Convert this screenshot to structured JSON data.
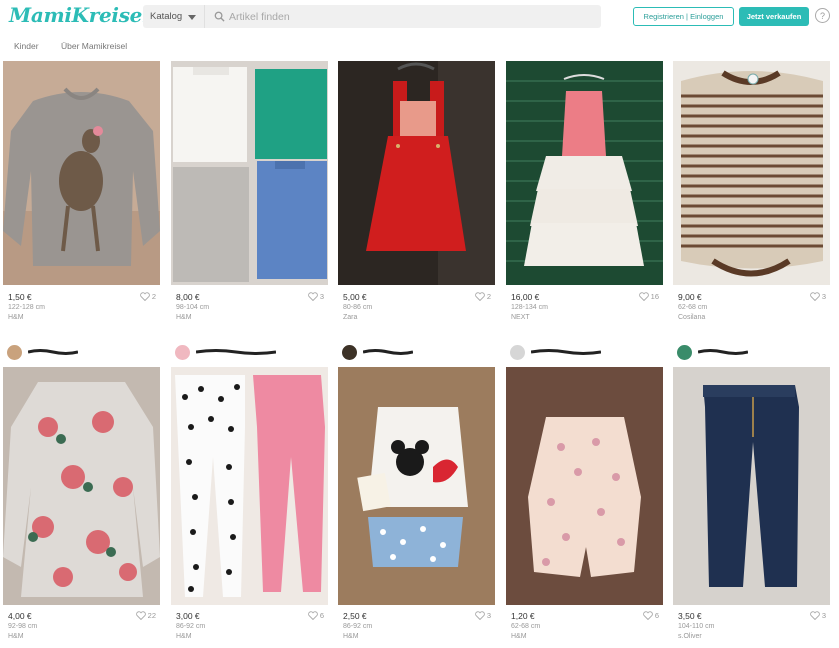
{
  "header": {
    "logo": "MamiKreisel",
    "catalog_label": "Katalog",
    "search_placeholder": "Artikel finden",
    "register_label": "Registrieren | Einloggen",
    "sell_label": "Jetzt verkaufen",
    "help_label": "?"
  },
  "subnav": {
    "items": [
      {
        "label": "Kinder"
      },
      {
        "label": "Über Mamikreisel"
      }
    ]
  },
  "items": [
    {
      "price": "1,50 €",
      "size": "122-128 cm",
      "brand": "H&M",
      "likes": "2",
      "photo": "deer-sweater",
      "bg": "#c0a590"
    },
    {
      "price": "8,00 €",
      "size": "98-104 cm",
      "brand": "H&M",
      "likes": "3",
      "photo": "four-shirts",
      "bg": "#d9d4cf"
    },
    {
      "price": "5,00 €",
      "size": "80-86 cm",
      "brand": "Zara",
      "likes": "2",
      "photo": "red-dress",
      "bg": "#2a2420"
    },
    {
      "price": "16,00 €",
      "size": "128-134 cm",
      "brand": "NEXT",
      "likes": "16",
      "photo": "pink-dress",
      "bg": "#1f4a33"
    },
    {
      "price": "9,00 €",
      "size": "62-68 cm",
      "brand": "Cosilana",
      "likes": "3",
      "photo": "striped-body",
      "bg": "#e8e4de"
    },
    {
      "price": "4,00 €",
      "size": "92-98 cm",
      "brand": "H&M",
      "likes": "22",
      "photo": "floral-dress",
      "bg": "#bfb5ac",
      "avatar": "#c9a27d"
    },
    {
      "price": "3,00 €",
      "size": "86-92 cm",
      "brand": "H&M",
      "likes": "6",
      "photo": "leggings",
      "bg": "#efe9e4",
      "avatar": "#f0b8c0"
    },
    {
      "price": "2,50 €",
      "size": "86-92 cm",
      "brand": "H&M",
      "likes": "3",
      "photo": "minnie-set",
      "bg": "#9b7a5c",
      "avatar": "#3d3227"
    },
    {
      "price": "1,20 €",
      "size": "62-68 cm",
      "brand": "H&M",
      "likes": "6",
      "photo": "butterfly-romper",
      "bg": "#6e4d3f",
      "avatar": "#cfcfcf"
    },
    {
      "price": "3,50 €",
      "size": "104-110 cm",
      "brand": "s.Oliver",
      "likes": "3",
      "photo": "jeans",
      "bg": "#d7d3cf",
      "avatar": "#3a8c6a"
    }
  ],
  "colors": {
    "accent": "#2cbcb6"
  }
}
